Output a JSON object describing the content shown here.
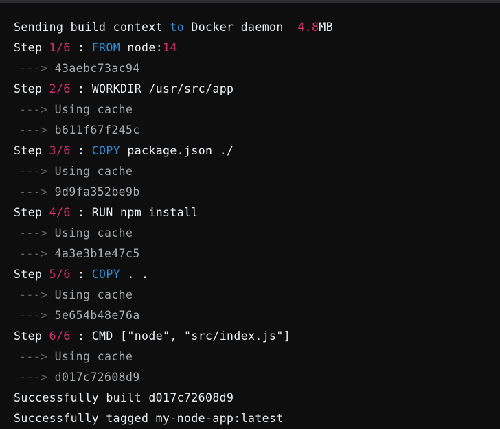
{
  "terminal": {
    "background_color": "#0e0e0f",
    "title_bar_color": "#2b2e2f",
    "colors": {
      "white": "#eceff1",
      "blue": "#2f8fd6",
      "pink": "#d4336f",
      "arrow_gray": "#5d6164",
      "dim_gray": "#a2a6a8",
      "hash_gray": "#a9adaf"
    },
    "lines": [
      {
        "id": "sending-build-context",
        "indent": "top",
        "tokens": [
          {
            "text": "Sending build context ",
            "color": "white"
          },
          {
            "text": "to",
            "color": "blue"
          },
          {
            "text": " Docker daemon  ",
            "color": "white"
          },
          {
            "text": "4.8",
            "color": "pink"
          },
          {
            "text": "MB",
            "color": "white"
          }
        ]
      },
      {
        "id": "step-1",
        "indent": "top",
        "tokens": [
          {
            "text": "Step ",
            "color": "white"
          },
          {
            "text": "1/6",
            "color": "pink"
          },
          {
            "text": " : ",
            "color": "white"
          },
          {
            "text": "FROM",
            "color": "blue"
          },
          {
            "text": " node:",
            "color": "white"
          },
          {
            "text": "14",
            "color": "pink"
          }
        ]
      },
      {
        "id": "step-1-hash",
        "indent": "indent",
        "tokens": [
          {
            "text": "---> ",
            "color": "arrow_gray"
          },
          {
            "text": "43aebc73ac94",
            "color": "hash_gray"
          }
        ]
      },
      {
        "id": "step-2",
        "indent": "top",
        "tokens": [
          {
            "text": "Step ",
            "color": "white"
          },
          {
            "text": "2/6",
            "color": "pink"
          },
          {
            "text": " : WORKDIR /usr/src/app",
            "color": "white"
          }
        ]
      },
      {
        "id": "step-2-cache",
        "indent": "indent",
        "tokens": [
          {
            "text": "---> ",
            "color": "arrow_gray"
          },
          {
            "text": "Using cache",
            "color": "dim_gray"
          }
        ]
      },
      {
        "id": "step-2-hash",
        "indent": "indent",
        "tokens": [
          {
            "text": "---> ",
            "color": "arrow_gray"
          },
          {
            "text": "b611f67f245c",
            "color": "hash_gray"
          }
        ]
      },
      {
        "id": "step-3",
        "indent": "top",
        "tokens": [
          {
            "text": "Step ",
            "color": "white"
          },
          {
            "text": "3/6",
            "color": "pink"
          },
          {
            "text": " : ",
            "color": "white"
          },
          {
            "text": "COPY",
            "color": "blue"
          },
          {
            "text": " package.json ./",
            "color": "white"
          }
        ]
      },
      {
        "id": "step-3-cache",
        "indent": "indent",
        "tokens": [
          {
            "text": "---> ",
            "color": "arrow_gray"
          },
          {
            "text": "Using cache",
            "color": "dim_gray"
          }
        ]
      },
      {
        "id": "step-3-hash",
        "indent": "indent",
        "tokens": [
          {
            "text": "---> ",
            "color": "arrow_gray"
          },
          {
            "text": "9d9fa352be9b",
            "color": "hash_gray"
          }
        ]
      },
      {
        "id": "step-4",
        "indent": "top",
        "tokens": [
          {
            "text": "Step ",
            "color": "white"
          },
          {
            "text": "4/6",
            "color": "pink"
          },
          {
            "text": " : RUN npm install",
            "color": "white"
          }
        ]
      },
      {
        "id": "step-4-cache",
        "indent": "indent",
        "tokens": [
          {
            "text": "---> ",
            "color": "arrow_gray"
          },
          {
            "text": "Using cache",
            "color": "dim_gray"
          }
        ]
      },
      {
        "id": "step-4-hash",
        "indent": "indent",
        "tokens": [
          {
            "text": "---> ",
            "color": "arrow_gray"
          },
          {
            "text": "4a3e3b1e47c5",
            "color": "hash_gray"
          }
        ]
      },
      {
        "id": "step-5",
        "indent": "top",
        "tokens": [
          {
            "text": "Step ",
            "color": "white"
          },
          {
            "text": "5/6",
            "color": "pink"
          },
          {
            "text": " : ",
            "color": "white"
          },
          {
            "text": "COPY",
            "color": "blue"
          },
          {
            "text": " . .",
            "color": "white"
          }
        ]
      },
      {
        "id": "step-5-cache",
        "indent": "indent",
        "tokens": [
          {
            "text": "---> ",
            "color": "arrow_gray"
          },
          {
            "text": "Using cache",
            "color": "dim_gray"
          }
        ]
      },
      {
        "id": "step-5-hash",
        "indent": "indent",
        "tokens": [
          {
            "text": "---> ",
            "color": "arrow_gray"
          },
          {
            "text": "5e654b48e76a",
            "color": "hash_gray"
          }
        ]
      },
      {
        "id": "step-6",
        "indent": "top",
        "tokens": [
          {
            "text": "Step ",
            "color": "white"
          },
          {
            "text": "6/6",
            "color": "pink"
          },
          {
            "text": " : CMD [\"node\", \"src/index.js\"]",
            "color": "white"
          }
        ]
      },
      {
        "id": "step-6-cache",
        "indent": "indent",
        "tokens": [
          {
            "text": "---> ",
            "color": "arrow_gray"
          },
          {
            "text": "Using cache",
            "color": "dim_gray"
          }
        ]
      },
      {
        "id": "step-6-hash",
        "indent": "indent",
        "tokens": [
          {
            "text": "---> ",
            "color": "arrow_gray"
          },
          {
            "text": "d017c72608d9",
            "color": "hash_gray"
          }
        ]
      },
      {
        "id": "successfully-built",
        "indent": "top",
        "tokens": [
          {
            "text": "Successfully built d017c72608d9",
            "color": "white"
          }
        ]
      },
      {
        "id": "successfully-tagged",
        "indent": "top",
        "tokens": [
          {
            "text": "Successfully tagged my-node-app:latest",
            "color": "white"
          }
        ]
      }
    ]
  }
}
